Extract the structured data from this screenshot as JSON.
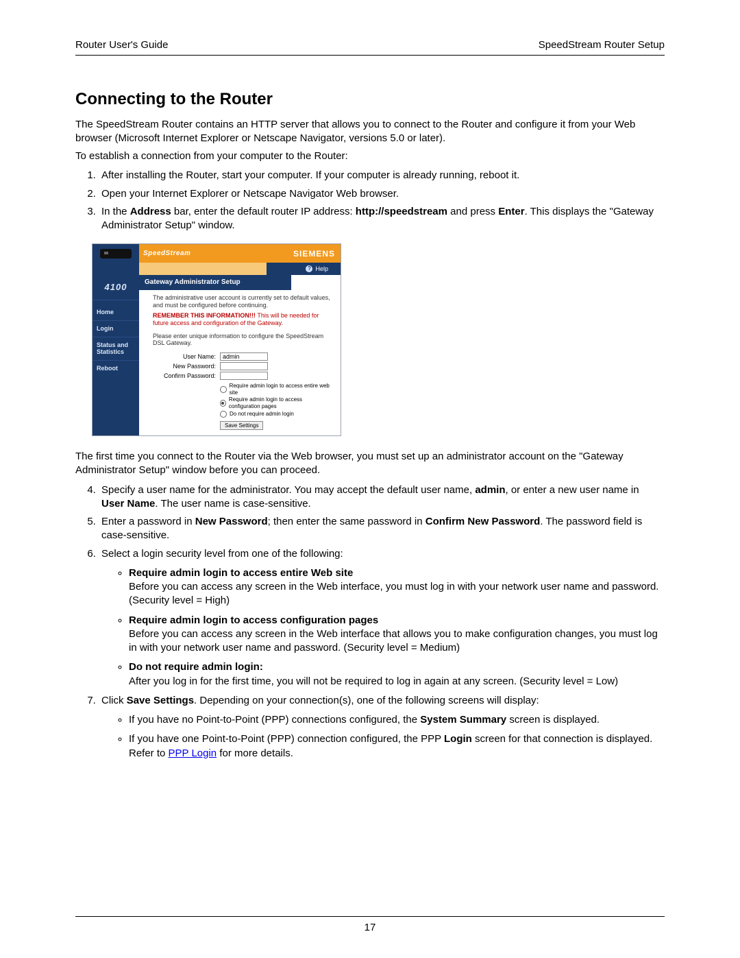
{
  "header": {
    "left": "Router User's Guide",
    "right": "SpeedStream Router Setup"
  },
  "title": "Connecting to the Router",
  "intro1": "The SpeedStream Router contains an HTTP server that allows you to connect to the Router and configure it from your Web browser (Microsoft Internet Explorer or Netscape Navigator, versions 5.0 or later).",
  "intro2": "To establish a connection from your computer to the Router:",
  "step1": "After installing the Router, start your computer. If your computer is already running, reboot it.",
  "step2": "Open your Internet Explorer or Netscape Navigator Web browser.",
  "step3_pre": "In the ",
  "step3_b1": "Address",
  "step3_mid": " bar, enter the default router IP address: ",
  "step3_b2": "http://speedstream",
  "step3_mid2": " and press ",
  "step3_b3": "Enter",
  "step3_post": ". This displays the \"Gateway Administrator Setup\" window.",
  "after_shot": "The first time you connect to the Router via the Web browser, you must set up an administrator account on the \"Gateway Administrator Setup\" window before you can proceed.",
  "step4_a": "Specify a user name for the administrator. You may accept the default user name, ",
  "step4_admin": "admin",
  "step4_b": ", or enter a new user name in ",
  "step4_user": "User Name",
  "step4_c": ". The user name is case-sensitive.",
  "step5_a": "Enter a password in ",
  "step5_np": "New Password",
  "step5_b": "; then enter the same password in ",
  "step5_cp": "Confirm New Password",
  "step5_c": ". The password field is case-sensitive.",
  "step6": "Select a login security level from one of the following:",
  "opt1_t": "Require admin login to access entire Web site",
  "opt1_d": "Before you can access any screen in the Web interface, you must log in with your network user name and password. (Security level = High)",
  "opt2_t": "Require admin login to access configuration pages",
  "opt2_d": "Before you can access any screen in the Web interface that allows you to make configuration changes, you must log in with your network user name and password. (Security level = Medium)",
  "opt3_t": "Do not require admin login:",
  "opt3_d": "After you log in for the first time, you will not be required to log in again at any screen. (Security level = Low)",
  "step7_a": "Click ",
  "step7_save": "Save Settings",
  "step7_b": ". Depending on your connection(s), one of the following screens will display:",
  "sub1_a": "If you have no Point-to-Point (PPP) connections configured, the ",
  "sub1_b": "System Summary",
  "sub1_c": " screen is displayed.",
  "sub2_a": "If you have one Point-to-Point (PPP) connection configured, the PPP ",
  "sub2_b": "Login",
  "sub2_c": " screen for that connection is displayed. Refer to ",
  "sub2_link": "PPP Login",
  "sub2_d": " for more details.",
  "page_number": "17",
  "screenshot": {
    "brand": "SpeedStream",
    "siemens": "SIEMENS",
    "help": "Help",
    "model": "4100",
    "side_items": [
      "Home",
      "Login",
      "Status and Statistics",
      "Reboot"
    ],
    "panel_title": "Gateway Administrator Setup",
    "txt1": "The administrative user account is currently set to default values, and must be configured before continuing.",
    "warn_a": "REMEMBER THIS INFORMATION!!! ",
    "warn_b": "This will be needed for future access and configuration of the Gateway.",
    "txt2": "Please enter unique information to configure the SpeedStream DSL Gateway.",
    "labels": {
      "user": "User Name:",
      "newpw": "New Password:",
      "confpw": "Confirm Password:"
    },
    "user_value": "admin",
    "radios": [
      "Require admin login to access entire web site",
      "Require admin login to access configuration pages",
      "Do not require admin login"
    ],
    "save_btn": "Save Settings"
  }
}
